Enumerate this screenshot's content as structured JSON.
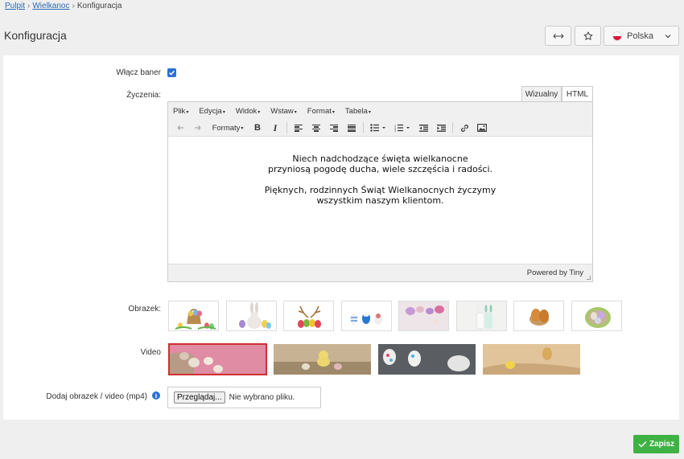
{
  "breadcrumb": {
    "items": [
      "Pulpit",
      "Wielkanoc"
    ],
    "current": "Konfiguracja"
  },
  "page": {
    "title": "Konfiguracja"
  },
  "header": {
    "language": "Polska"
  },
  "form": {
    "banner_label": "Włącz baner",
    "banner_checked": true,
    "wishes_label": "Życzenia:",
    "image_label": "Obrazek:",
    "video_label": "Video",
    "upload_label": "Dodaj obrazek / video (mp4)",
    "file_button": "Przeglądaj...",
    "file_status": "Nie wybrano pliku."
  },
  "editor": {
    "tabs": [
      "Wizualny",
      "HTML"
    ],
    "menu": [
      "Plik",
      "Edycja",
      "Widok",
      "Wstaw",
      "Format",
      "Tabela"
    ],
    "formats_label": "Formaty",
    "content": {
      "p1_line1": "Niech nadchodzące święta wielkanocne",
      "p1_line2": "przyniosą pogodę ducha, wiele szczęścia i radości.",
      "p2_line1": "Pięknych, rodzinnych Świąt Wielkanocnych życzymy",
      "p2_line2": "wszystkim naszym klientom."
    },
    "powered_by": "Powered by Tiny"
  },
  "actions": {
    "save": "Zapisz"
  },
  "colors": {
    "accent": "#2a6fd4",
    "save": "#3fb244",
    "selected": "#d03030"
  },
  "icons": [
    "resize-arrows-icon",
    "star-icon",
    "poland-flag-icon",
    "chevron-down-icon",
    "info-icon",
    "check-icon"
  ]
}
